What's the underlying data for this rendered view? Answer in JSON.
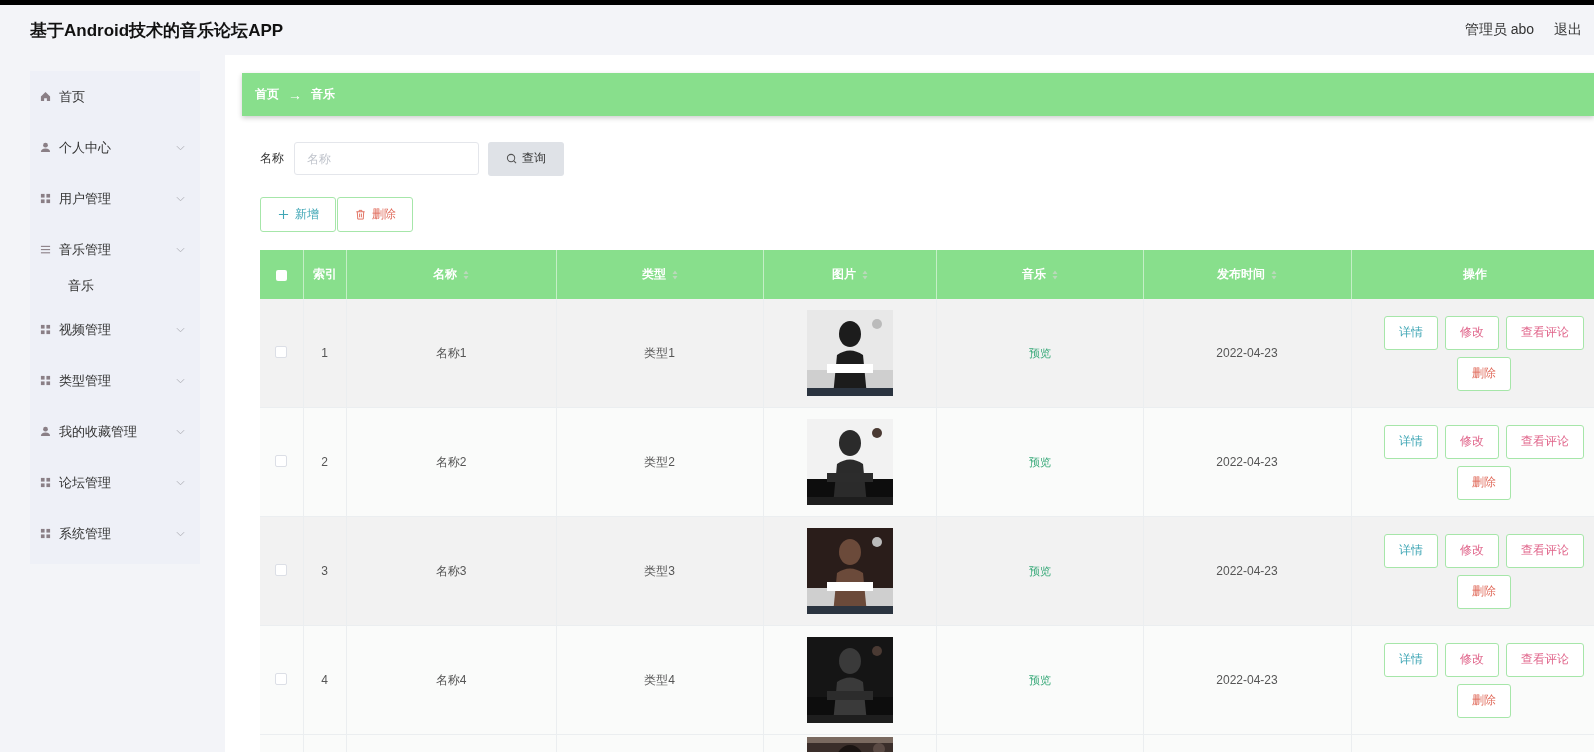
{
  "header": {
    "title": "基于Android技术的音乐论坛APP",
    "user": "管理员 abo",
    "logout": "退出"
  },
  "sidebar": {
    "items": [
      {
        "label": "首页",
        "kind": "home"
      },
      {
        "label": "个人中心",
        "kind": "user"
      },
      {
        "label": "用户管理",
        "kind": "grid"
      },
      {
        "label": "音乐管理",
        "kind": "list",
        "children": [
          {
            "label": "音乐"
          }
        ]
      },
      {
        "label": "视频管理",
        "kind": "grid"
      },
      {
        "label": "类型管理",
        "kind": "grid"
      },
      {
        "label": "我的收藏管理",
        "kind": "user"
      },
      {
        "label": "论坛管理",
        "kind": "grid"
      },
      {
        "label": "系统管理",
        "kind": "grid"
      }
    ]
  },
  "breadcrumb": [
    "首页",
    "→",
    "音乐"
  ],
  "search": {
    "label": "名称",
    "placeholder": "名称",
    "button": "查询"
  },
  "toolbar": [
    {
      "label": "新增",
      "kind": "add"
    },
    {
      "label": "删除",
      "kind": "delete"
    }
  ],
  "table": {
    "select_all": {
      "checked": false
    },
    "columns": [
      {
        "label": "索引",
        "sortable": false
      },
      {
        "label": "名称",
        "sortable": true
      },
      {
        "label": "类型",
        "sortable": true
      },
      {
        "label": "图片",
        "sortable": true
      },
      {
        "label": "音乐",
        "sortable": true
      },
      {
        "label": "发布时间",
        "sortable": true
      },
      {
        "label": "操作",
        "sortable": false
      }
    ],
    "rows": [
      {
        "checked": false,
        "index": "1",
        "name": "名称1",
        "type": "类型1",
        "music": "预览",
        "date": "2022-04-23",
        "actions": [
          "详情",
          "修改",
          "查看评论",
          "删除"
        ]
      },
      {
        "checked": false,
        "index": "2",
        "name": "名称2",
        "type": "类型2",
        "music": "预览",
        "date": "2022-04-23",
        "actions": [
          "详情",
          "修改",
          "查看评论",
          "删除"
        ]
      },
      {
        "checked": false,
        "index": "3",
        "name": "名称3",
        "type": "类型3",
        "music": "预览",
        "date": "2022-04-23",
        "actions": [
          "详情",
          "修改",
          "查看评论",
          "删除"
        ]
      },
      {
        "checked": false,
        "index": "4",
        "name": "名称4",
        "type": "类型4",
        "music": "预览",
        "date": "2022-04-23",
        "actions": [
          "详情",
          "修改",
          "查看评论",
          "删除"
        ]
      }
    ]
  }
}
